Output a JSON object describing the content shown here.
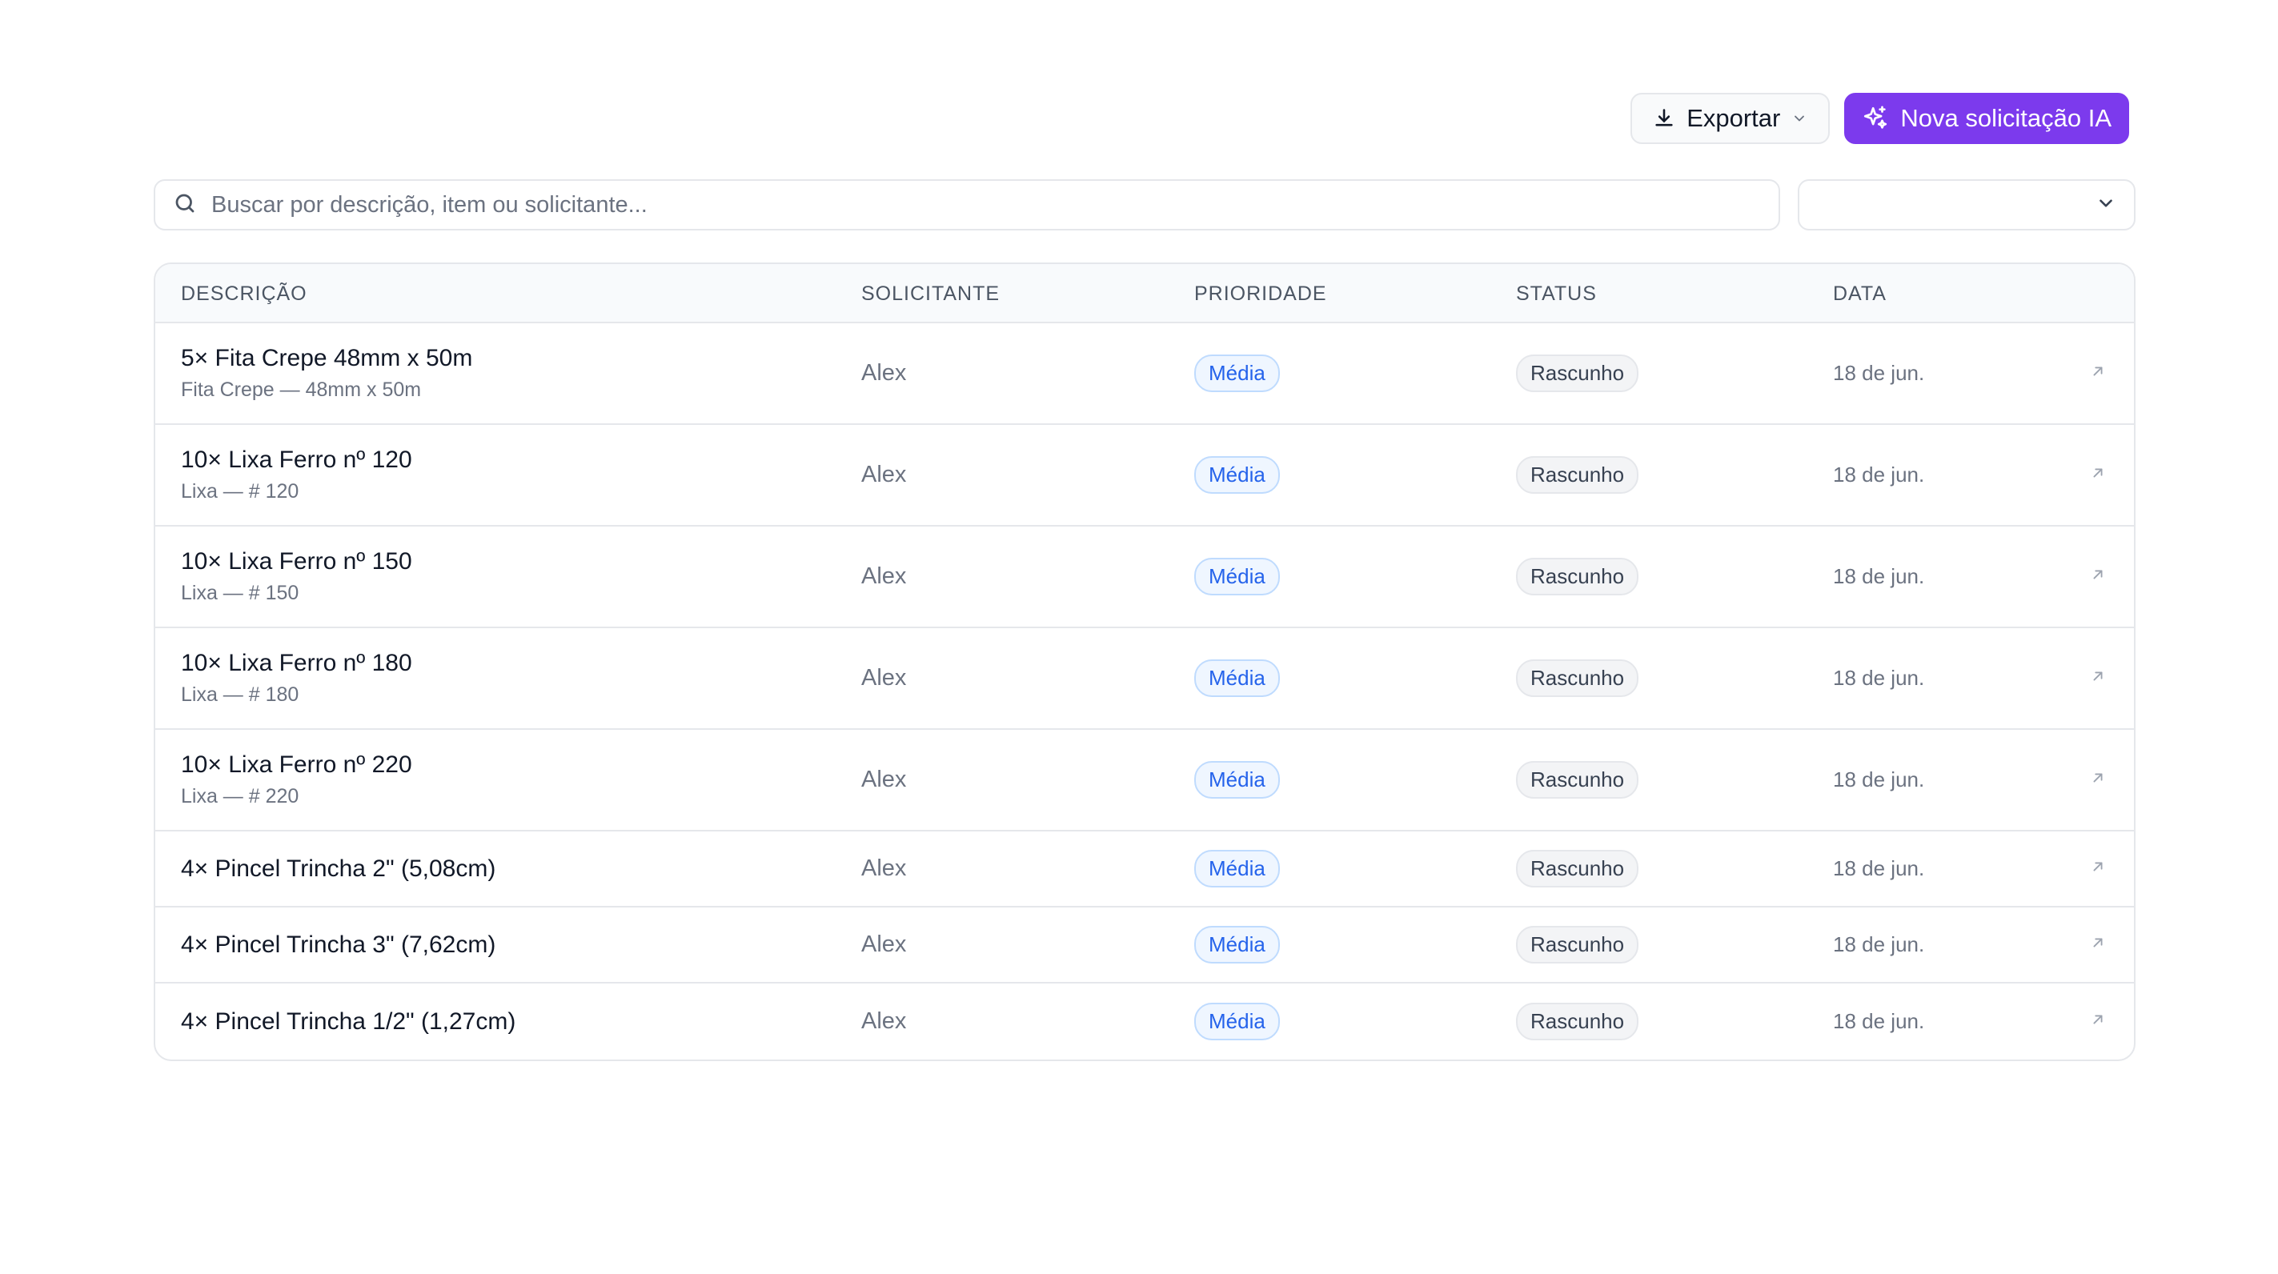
{
  "toolbar": {
    "export_label": "Exportar",
    "new_label": "Nova solicitação IA",
    "accent_color": "#7c3aed"
  },
  "filters": {
    "search_placeholder": "Buscar por descrição, item ou solicitante...",
    "select_value": ""
  },
  "table": {
    "headers": [
      "DESCRIÇÃO",
      "SOLICITANTE",
      "PRIORIDADE",
      "STATUS",
      "DATA"
    ],
    "rows": [
      {
        "title": "5× Fita Crepe 48mm x 50m",
        "subtitle": "Fita Crepe — 48mm x 50m",
        "requester": "Alex",
        "priority": "Média",
        "status": "Rascunho",
        "date": "18 de jun."
      },
      {
        "title": "10× Lixa Ferro nº 120",
        "subtitle": "Lixa — # 120",
        "requester": "Alex",
        "priority": "Média",
        "status": "Rascunho",
        "date": "18 de jun."
      },
      {
        "title": "10× Lixa Ferro nº 150",
        "subtitle": "Lixa — # 150",
        "requester": "Alex",
        "priority": "Média",
        "status": "Rascunho",
        "date": "18 de jun."
      },
      {
        "title": "10× Lixa Ferro nº 180",
        "subtitle": "Lixa — # 180",
        "requester": "Alex",
        "priority": "Média",
        "status": "Rascunho",
        "date": "18 de jun."
      },
      {
        "title": "10× Lixa Ferro nº 220",
        "subtitle": "Lixa — # 220",
        "requester": "Alex",
        "priority": "Média",
        "status": "Rascunho",
        "date": "18 de jun."
      },
      {
        "title": "4× Pincel Trincha 2\" (5,08cm)",
        "subtitle": "",
        "requester": "Alex",
        "priority": "Média",
        "status": "Rascunho",
        "date": "18 de jun."
      },
      {
        "title": "4× Pincel Trincha 3\" (7,62cm)",
        "subtitle": "",
        "requester": "Alex",
        "priority": "Média",
        "status": "Rascunho",
        "date": "18 de jun."
      },
      {
        "title": "4× Pincel Trincha 1/2\" (1,27cm)",
        "subtitle": "",
        "requester": "Alex",
        "priority": "Média",
        "status": "Rascunho",
        "date": "18 de jun."
      }
    ],
    "open_icon": "arrow-up-right-icon"
  }
}
